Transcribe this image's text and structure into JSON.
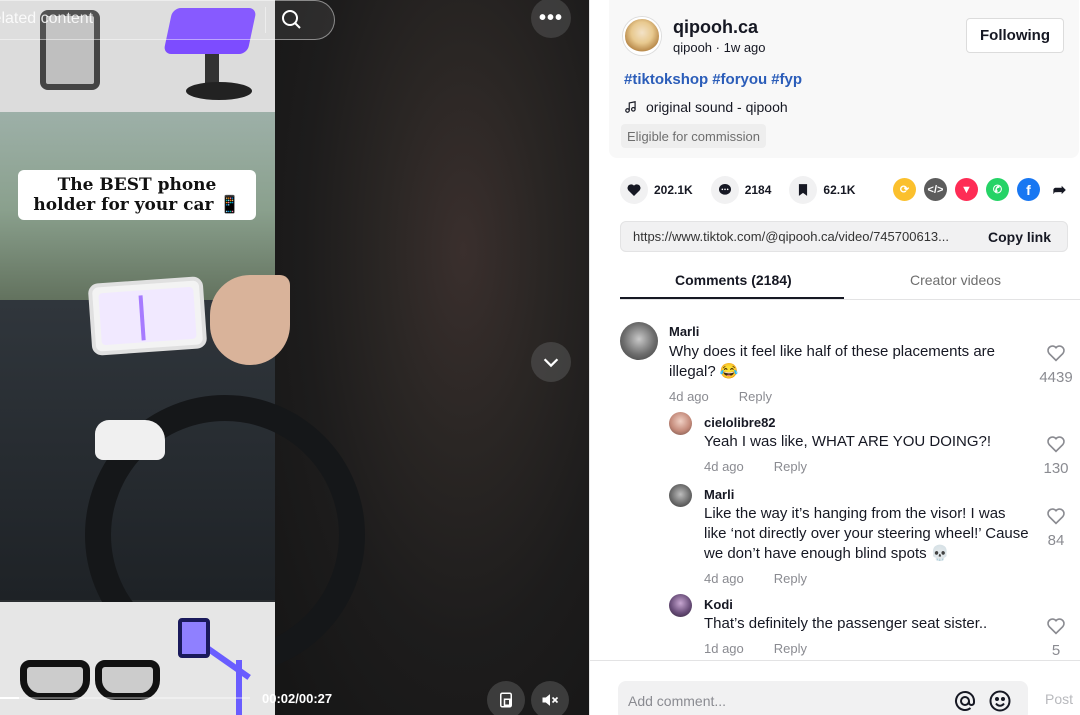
{
  "video": {
    "search_placeholder": "Related content",
    "caption": "The BEST phone holder for your car",
    "caption_emoji": "📱",
    "time_display": "00:02/00:27",
    "progress_fraction": 0.074
  },
  "author": {
    "name": "qipooh.ca",
    "handle": "qipooh",
    "posted": "1w ago",
    "subline": "qipooh · 1w ago",
    "follow_label": "Following",
    "hashtags": [
      "#tiktokshop",
      "#foryou",
      "#fyp"
    ],
    "sound": "original sound - qipooh",
    "commission_badge": "Eligible for commission"
  },
  "stats": {
    "likes": "202.1K",
    "comments": "2184",
    "saves": "62.1K"
  },
  "share_icons": [
    {
      "name": "repost-icon",
      "color": "#fbc02d"
    },
    {
      "name": "embed-icon",
      "color": "#5c5c5c"
    },
    {
      "name": "send-to-friends-icon",
      "color": "#fe2c55"
    },
    {
      "name": "whatsapp-icon",
      "color": "#25d366"
    },
    {
      "name": "facebook-icon",
      "color": "#1877f2"
    },
    {
      "name": "share-arrow-icon",
      "color": "#161823"
    }
  ],
  "link": {
    "url": "https://www.tiktok.com/@qipooh.ca/video/745700613...",
    "copy_label": "Copy link"
  },
  "tabs": {
    "comments": "Comments (2184)",
    "creator": "Creator videos"
  },
  "comments": [
    {
      "user": "Marli",
      "text": "Why does it feel like half of these placements are illegal? 😂",
      "time": "4d ago",
      "reply": "Reply",
      "likes": "4439",
      "replies": [
        {
          "user": "cielolibre82",
          "text": "Yeah I was like, WHAT ARE YOU DOING?!",
          "time": "4d ago",
          "reply": "Reply",
          "likes": "130"
        },
        {
          "user": "Marli",
          "text": "Like the way it’s hanging from the visor! I was like ‘not directly over your steering wheel!’ Cause we don’t have enough blind spots 💀",
          "time": "4d ago",
          "reply": "Reply",
          "likes": "84"
        },
        {
          "user": "Kodi",
          "text": "That’s definitely the passenger seat sister..",
          "time": "1d ago",
          "reply": "Reply",
          "likes": "5"
        }
      ]
    }
  ],
  "comment_bar": {
    "placeholder": "Add comment...",
    "post_label": "Post"
  }
}
